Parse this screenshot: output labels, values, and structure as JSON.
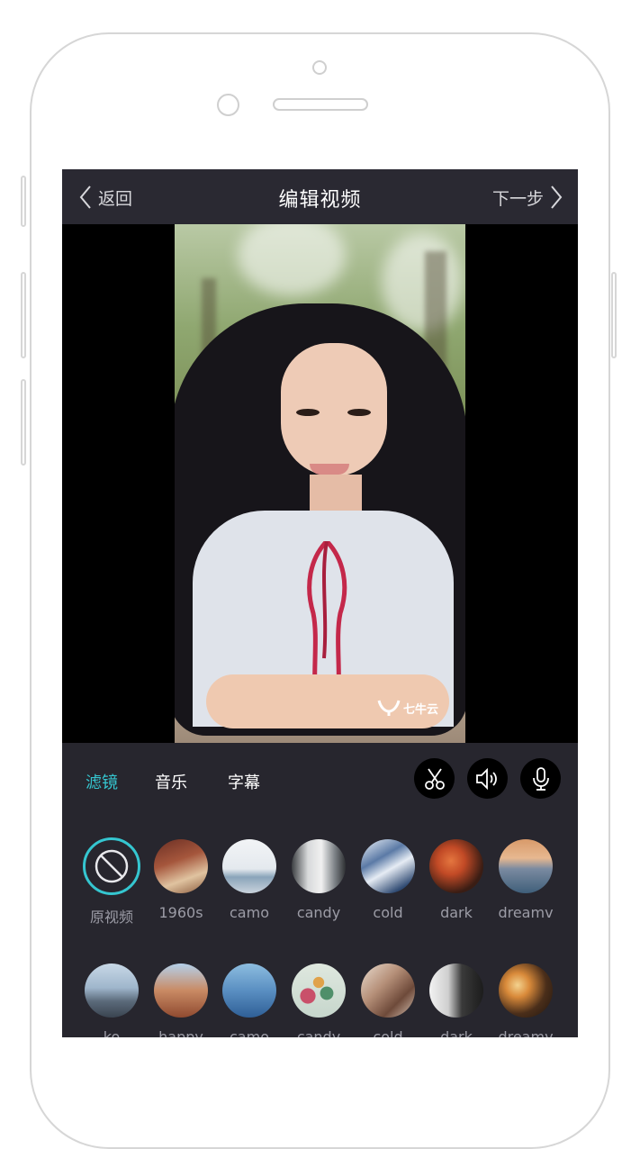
{
  "nav": {
    "back_label": "返回",
    "title": "编辑视频",
    "next_label": "下一步"
  },
  "video": {
    "watermark_text": "七牛云"
  },
  "tabs": [
    {
      "label": "滤镜",
      "active": true
    },
    {
      "label": "音乐",
      "active": false
    },
    {
      "label": "字幕",
      "active": false
    }
  ],
  "tools": [
    {
      "icon": "scissors-icon"
    },
    {
      "icon": "speaker-icon"
    },
    {
      "icon": "microphone-icon"
    }
  ],
  "filters": [
    {
      "label": "原视频",
      "selected": true,
      "colors": [
        "#000000",
        "#000000"
      ]
    },
    {
      "label": "1960s",
      "colors": [
        "#7a3b2a",
        "#d6b08c"
      ]
    },
    {
      "label": "camo",
      "colors": [
        "#e9eef2",
        "#9bb0c2"
      ]
    },
    {
      "label": "candy",
      "colors": [
        "#6a6e70",
        "#e4e4e4"
      ]
    },
    {
      "label": "cold",
      "colors": [
        "#3e5e8a",
        "#e8eef6"
      ]
    },
    {
      "label": "dark",
      "colors": [
        "#3a1f16",
        "#d2693a"
      ]
    },
    {
      "label": "dreamv",
      "colors": [
        "#6c8aa8",
        "#c47b4a"
      ]
    }
  ],
  "filters_row2": [
    {
      "label": "ko",
      "colors": [
        "#a9c0d6",
        "#5e6e80"
      ]
    },
    {
      "label": "happy",
      "colors": [
        "#a6c4e2",
        "#b06a48"
      ]
    },
    {
      "label": "camo",
      "colors": [
        "#7fb0d6",
        "#3c6ea6"
      ]
    },
    {
      "label": "candy",
      "colors": [
        "#d1e2d2",
        "#b6505a"
      ]
    },
    {
      "label": "cold",
      "colors": [
        "#7d5848",
        "#e6d6c8"
      ]
    },
    {
      "label": "dark",
      "colors": [
        "#efefef",
        "#2a2a2a"
      ]
    },
    {
      "label": "dreamv",
      "colors": [
        "#3a2a1a",
        "#e6b070"
      ]
    }
  ],
  "colors": {
    "accent": "#35c6d0",
    "screen_bg": "#27262e",
    "label_gray": "#9c9ca6"
  }
}
